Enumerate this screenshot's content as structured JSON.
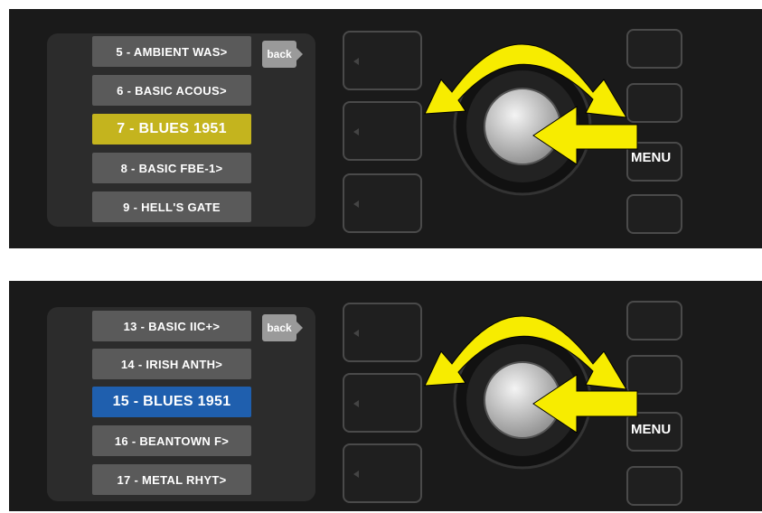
{
  "panels": [
    {
      "presets": [
        "5 - AMBIENT WAS>",
        "6 - BASIC ACOUS>",
        "7 - BLUES 1951",
        "8 - BASIC FBE-1>",
        "9 - HELL'S GATE"
      ],
      "selected_index": 2,
      "highlight_color": "#c4b41e",
      "back_label": "back",
      "menu_label": "MENU"
    },
    {
      "presets": [
        "13 - BASIC IIC+>",
        "14 - IRISH ANTH>",
        "15 - BLUES 1951",
        "16 - BEANTOWN F>",
        "17 - METAL RHYT>"
      ],
      "selected_index": 2,
      "highlight_color": "#1f5fae",
      "back_label": "back",
      "menu_label": "MENU"
    }
  ],
  "colors": {
    "panel": "#1a1a1a",
    "item": "#5a5a5a",
    "arrow": "#f7ec00"
  },
  "icons": [
    "rotate-arrows-icon",
    "push-arrow-icon",
    "encoder-knob"
  ]
}
